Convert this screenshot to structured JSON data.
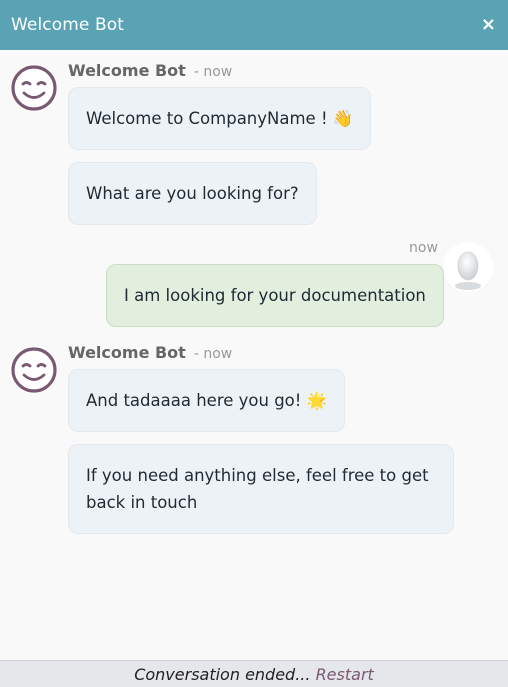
{
  "header": {
    "title": "Welcome Bot",
    "close_icon": "×"
  },
  "messages": [
    {
      "author": "Welcome Bot",
      "time": "- now",
      "bubbles": [
        "Welcome to CompanyName ! 👋",
        "What are you looking for?"
      ]
    },
    {
      "time": "now",
      "bubbles": [
        "I am looking for your documentation"
      ]
    },
    {
      "author": "Welcome Bot",
      "time": "- now",
      "bubbles": [
        "And tadaaaa here you go! 🌟",
        "If you need anything else, feel free to get back in touch"
      ]
    }
  ],
  "footer": {
    "ended_text": "Conversation ended... ",
    "restart_label": "Restart"
  },
  "colors": {
    "header_bg": "#5aa3b4",
    "bot_bubble": "#edf2f6",
    "user_bubble": "#e2efdf",
    "bot_avatar_stroke": "#7a5972",
    "restart_link": "#7a5972"
  }
}
